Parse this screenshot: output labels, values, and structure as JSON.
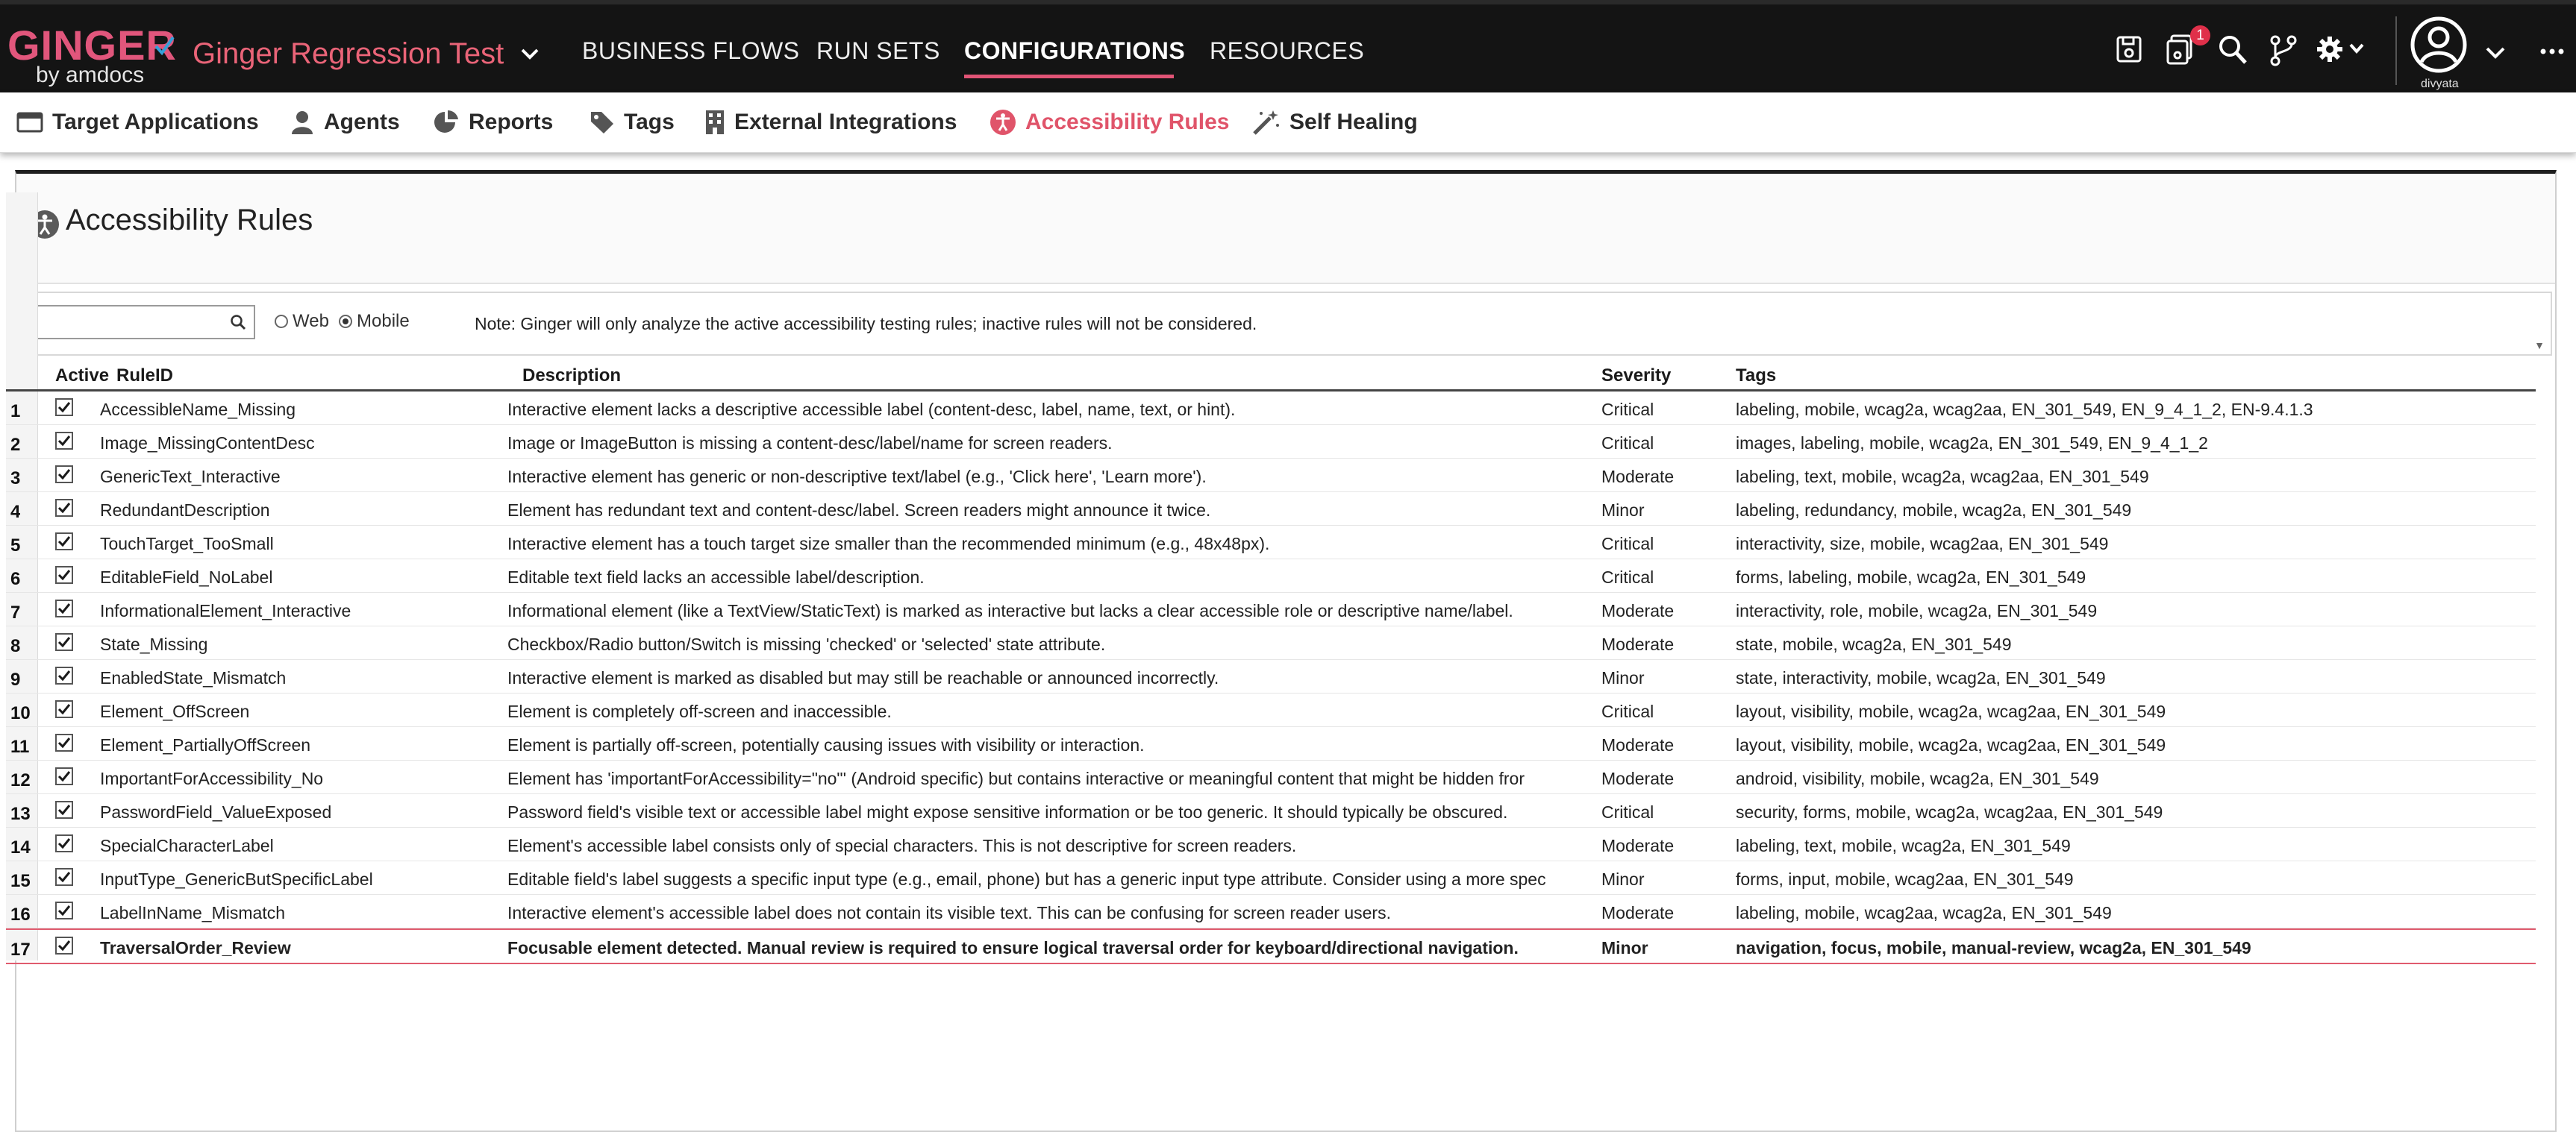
{
  "app": {
    "logo_text": "GINGER",
    "logo_sub": "by amdocs",
    "project": "Ginger Regression Test",
    "user": "divyata",
    "notification_count": "1"
  },
  "main_nav": [
    {
      "label": "BUSINESS FLOWS"
    },
    {
      "label": "RUN SETS"
    },
    {
      "label": "CONFIGURATIONS",
      "active": true
    },
    {
      "label": "RESOURCES"
    }
  ],
  "toolbar_icons": [
    "save-icon",
    "save-all-icon",
    "search-icon",
    "source-control-icon",
    "settings-icon",
    "user-avatar-icon",
    "more-icon"
  ],
  "sub_nav": [
    {
      "label": "Target Applications",
      "icon": "window-icon"
    },
    {
      "label": "Agents",
      "icon": "agent-icon"
    },
    {
      "label": "Reports",
      "icon": "pie-chart-icon"
    },
    {
      "label": "Tags",
      "icon": "tag-icon"
    },
    {
      "label": "External Integrations",
      "icon": "building-icon"
    },
    {
      "label": "Accessibility Rules",
      "icon": "accessibility-icon",
      "active": true
    },
    {
      "label": "Self Healing",
      "icon": "magic-wand-icon"
    }
  ],
  "page": {
    "title": "Accessibility Rules",
    "search_value": "",
    "radio_web": "Web",
    "radio_mobile": "Mobile",
    "selected_radio": "Mobile",
    "note": "Note: Ginger will only analyze the active accessibility testing rules; inactive rules will not be considered."
  },
  "grid": {
    "columns": {
      "active": "Active",
      "rule_id": "RuleID",
      "description": "Description",
      "severity": "Severity",
      "tags": "Tags"
    },
    "rows": [
      {
        "num": "1",
        "active": true,
        "rule_id": "AccessibleName_Missing",
        "description": "Interactive element lacks a descriptive accessible label (content-desc, label, name, text, or hint).",
        "severity": "Critical",
        "tags": "labeling, mobile, wcag2a, wcag2aa, EN_301_549, EN_9_4_1_2, EN-9.4.1.3"
      },
      {
        "num": "2",
        "active": true,
        "rule_id": "Image_MissingContentDesc",
        "description": "Image or ImageButton is missing a content-desc/label/name for screen readers.",
        "severity": "Critical",
        "tags": "images, labeling, mobile, wcag2a, EN_301_549, EN_9_4_1_2"
      },
      {
        "num": "3",
        "active": true,
        "rule_id": "GenericText_Interactive",
        "description": "Interactive element has generic or non-descriptive text/label (e.g., 'Click here', 'Learn more').",
        "severity": "Moderate",
        "tags": "labeling, text, mobile, wcag2a, wcag2aa, EN_301_549"
      },
      {
        "num": "4",
        "active": true,
        "rule_id": "RedundantDescription",
        "description": "Element has redundant text and content-desc/label. Screen readers might announce it twice.",
        "severity": "Minor",
        "tags": "labeling, redundancy, mobile, wcag2a, EN_301_549"
      },
      {
        "num": "5",
        "active": true,
        "rule_id": "TouchTarget_TooSmall",
        "description": "Interactive element has a touch target size smaller than the recommended minimum (e.g., 48x48px).",
        "severity": "Critical",
        "tags": "interactivity, size, mobile, wcag2aa, EN_301_549"
      },
      {
        "num": "6",
        "active": true,
        "rule_id": "EditableField_NoLabel",
        "description": "Editable text field lacks an accessible label/description.",
        "severity": "Critical",
        "tags": "forms, labeling, mobile, wcag2a, EN_301_549"
      },
      {
        "num": "7",
        "active": true,
        "rule_id": "InformationalElement_Interactive",
        "description": "Informational element (like a TextView/StaticText) is marked as interactive but lacks a clear accessible role or descriptive name/label.",
        "severity": "Moderate",
        "tags": "interactivity, role, mobile, wcag2a, EN_301_549"
      },
      {
        "num": "8",
        "active": true,
        "rule_id": "State_Missing",
        "description": "Checkbox/Radio button/Switch is missing 'checked' or 'selected' state attribute.",
        "severity": "Moderate",
        "tags": "state, mobile, wcag2a, EN_301_549"
      },
      {
        "num": "9",
        "active": true,
        "rule_id": "EnabledState_Mismatch",
        "description": "Interactive element is marked as disabled but may still be reachable or announced incorrectly.",
        "severity": "Minor",
        "tags": "state, interactivity, mobile, wcag2a, EN_301_549"
      },
      {
        "num": "10",
        "active": true,
        "rule_id": "Element_OffScreen",
        "description": "Element is completely off-screen and inaccessible.",
        "severity": "Critical",
        "tags": "layout, visibility, mobile, wcag2a, wcag2aa, EN_301_549"
      },
      {
        "num": "11",
        "active": true,
        "rule_id": "Element_PartiallyOffScreen",
        "description": "Element is partially off-screen, potentially causing issues with visibility or interaction.",
        "severity": "Moderate",
        "tags": "layout, visibility, mobile, wcag2a, wcag2aa, EN_301_549"
      },
      {
        "num": "12",
        "active": true,
        "rule_id": "ImportantForAccessibility_No",
        "description": "Element has 'importantForAccessibility=\"no\"' (Android specific) but contains interactive or meaningful content that might be hidden fror",
        "severity": "Moderate",
        "tags": "android, visibility, mobile, wcag2a, EN_301_549"
      },
      {
        "num": "13",
        "active": true,
        "rule_id": "PasswordField_ValueExposed",
        "description": "Password field's visible text or accessible label might expose sensitive information or be too generic. It should typically be obscured.",
        "severity": "Critical",
        "tags": "security, forms, mobile, wcag2a, wcag2aa, EN_301_549"
      },
      {
        "num": "14",
        "active": true,
        "rule_id": "SpecialCharacterLabel",
        "description": "Element's accessible label consists only of special characters. This is not descriptive for screen readers.",
        "severity": "Moderate",
        "tags": "labeling, text, mobile, wcag2a, EN_301_549"
      },
      {
        "num": "15",
        "active": true,
        "rule_id": "InputType_GenericButSpecificLabel",
        "description": "Editable field's label suggests a specific input type (e.g., email, phone) but has a generic input type attribute. Consider using a more spec",
        "severity": "Minor",
        "tags": "forms, input, mobile, wcag2aa, EN_301_549"
      },
      {
        "num": "16",
        "active": true,
        "rule_id": "LabelInName_Mismatch",
        "description": "Interactive element's accessible label does not contain its visible text. This can be confusing for screen reader users.",
        "severity": "Moderate",
        "tags": "labeling, mobile, wcag2aa, wcag2a, EN_301_549"
      },
      {
        "num": "17",
        "active": true,
        "selected": true,
        "rule_id": "TraversalOrder_Review",
        "description": "Focusable element detected. Manual review is required to ensure logical traversal order for keyboard/directional navigation.",
        "severity": "Minor",
        "tags": "navigation, focus, mobile, manual-review, wcag2a, EN_301_549"
      }
    ]
  },
  "colors": {
    "brand": "#e1567c",
    "accent": "#e15476",
    "topbar": "#141414"
  }
}
